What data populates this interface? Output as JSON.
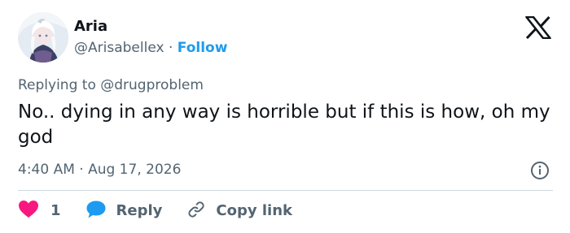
{
  "author": {
    "name": "Aria",
    "handle": "@Arisabellex",
    "separator": "·",
    "follow_label": "Follow"
  },
  "brand": {
    "logo_icon": "x-logo-icon",
    "logo_color": "#0f1419"
  },
  "tweet": {
    "replying_to": "Replying to @drugproblem",
    "text": "No.. dying in any way is horrible but if this is how, oh my god",
    "time": "4:40 AM · Aug 17, 2026",
    "info_icon": "info-icon"
  },
  "actions": {
    "like_count": "1",
    "like_icon": "heart-icon",
    "like_color": "#f91880",
    "reply_label": "Reply",
    "reply_icon": "speech-bubble-icon",
    "reply_color": "#1d9bf0",
    "copy_link_label": "Copy link",
    "copy_link_icon": "link-icon"
  },
  "colors": {
    "accent": "#1d9bf0",
    "text_primary": "#0f1419",
    "text_secondary": "#536471",
    "divider": "#cfd9de"
  }
}
